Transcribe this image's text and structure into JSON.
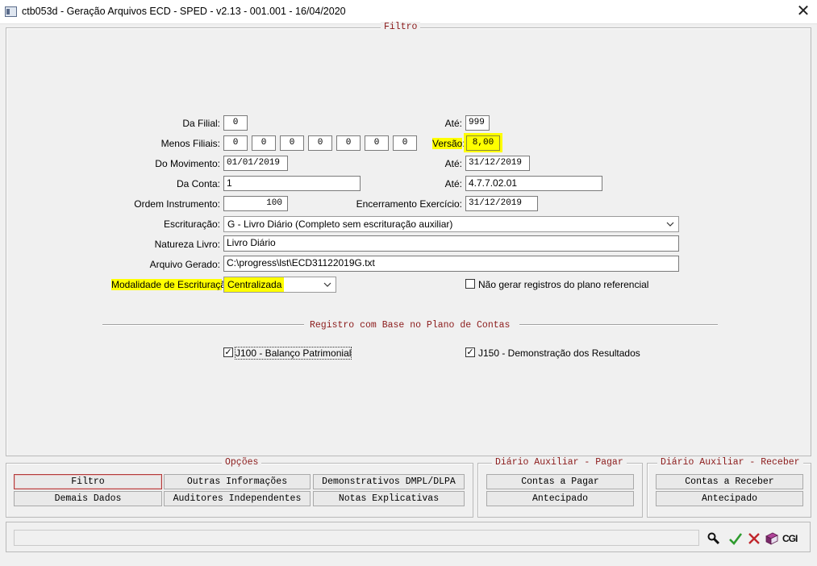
{
  "window": {
    "title": "ctb053d - Geração Arquivos ECD - SPED - v2.13 - 001.001 - 16/04/2020"
  },
  "filtro": {
    "legend": "Filtro",
    "da_filial_label": "Da Filial:",
    "da_filial": "0",
    "ate_filial_label": "Até:",
    "ate_filial": "999",
    "menos_filiais_label": "Menos Filiais:",
    "menos_filiais": [
      "0",
      "0",
      "0",
      "0",
      "0",
      "0",
      "0"
    ],
    "versao_label": "Versão:",
    "versao": "8,00",
    "do_movimento_label": "Do Movimento:",
    "do_movimento": "01/01/2019",
    "ate_movimento_label": "Até:",
    "ate_movimento": "31/12/2019",
    "da_conta_label": "Da Conta:",
    "da_conta": "1",
    "ate_conta_label": "Até:",
    "ate_conta": "4.7.7.02.01",
    "ordem_label": "Ordem Instrumento:",
    "ordem": "100",
    "encerramento_label": "Encerramento Exercício:",
    "encerramento": "31/12/2019",
    "escrituracao_label": "Escrituração:",
    "escrituracao": "G - Livro Diário (Completo sem escrituração auxiliar)",
    "natureza_label": "Natureza Livro:",
    "natureza": "Livro Diário",
    "arquivo_label": "Arquivo Gerado:",
    "arquivo": "C:\\progress\\lst\\ECD31122019G.txt",
    "modalidade_label": "Modalidade de Escrituração:",
    "modalidade": "Centralizada",
    "nao_gerar_label": "Não gerar registros do plano referencial",
    "nao_gerar_checked": false
  },
  "registro": {
    "legend": "Registro com Base no Plano de Contas",
    "j100_label": "J100 - Balanço Patrimonial",
    "j100_checked": true,
    "j150_label": "J150 - Demonstração dos Resultados",
    "j150_checked": true
  },
  "opcoes": {
    "legend": "Opções",
    "buttons": [
      "Filtro",
      "Outras Informações",
      "Demonstrativos DMPL/DLPA",
      "Demais Dados",
      "Auditores Independentes",
      "Notas Explicativas"
    ]
  },
  "diario_pagar": {
    "legend": "Diário Auxiliar - Pagar",
    "buttons": [
      "Contas a Pagar",
      "Antecipado"
    ]
  },
  "diario_receber": {
    "legend": "Diário Auxiliar - Receber",
    "buttons": [
      "Contas a Receber",
      "Antecipado"
    ]
  },
  "status": {
    "text": "",
    "logo": "CGI"
  },
  "colors": {
    "highlight": "#ffff00",
    "legend_text": "#8b1a1a",
    "confirm_green": "#2e9b2e",
    "cancel_red": "#c0262c"
  }
}
